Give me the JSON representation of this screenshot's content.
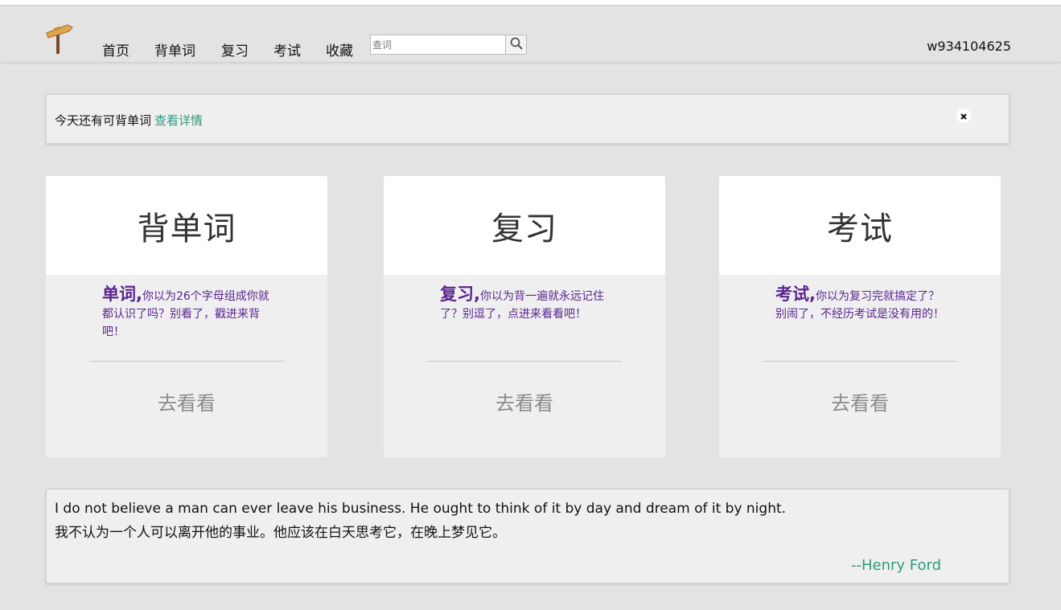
{
  "nav": {
    "items": [
      "首页",
      "背单词",
      "复习",
      "考试",
      "收藏"
    ],
    "search_placeholder": "查词",
    "username": "w934104625"
  },
  "notice": {
    "text": "今天还有可背单词",
    "link": "查看详情"
  },
  "cards": [
    {
      "title": "背单词",
      "highlight": "单词,",
      "description": "你以为26个字母组成你就都认识了吗？别看了，戳进来背吧！",
      "action": "去看看"
    },
    {
      "title": "复习",
      "highlight": "复习,",
      "description": "你以为背一遍就永远记住了？别逗了，点进来看看吧！",
      "action": "去看看"
    },
    {
      "title": "考试",
      "highlight": "考试,",
      "description": "你以为复习完就搞定了？别闹了，不经历考试是没有用的！",
      "action": "去看看"
    }
  ],
  "quote": {
    "english": "I do not believe a man can ever leave his business. He ought to think of it by day and dream of it by night.",
    "chinese": "我不认为一个人可以离开他的事业。他应该在白天思考它，在晚上梦见它。",
    "author": "--Henry Ford"
  },
  "colors": {
    "accent_green": "#2e9a7e",
    "purple_text": "#5b2590",
    "background": "#e3e3e3"
  }
}
